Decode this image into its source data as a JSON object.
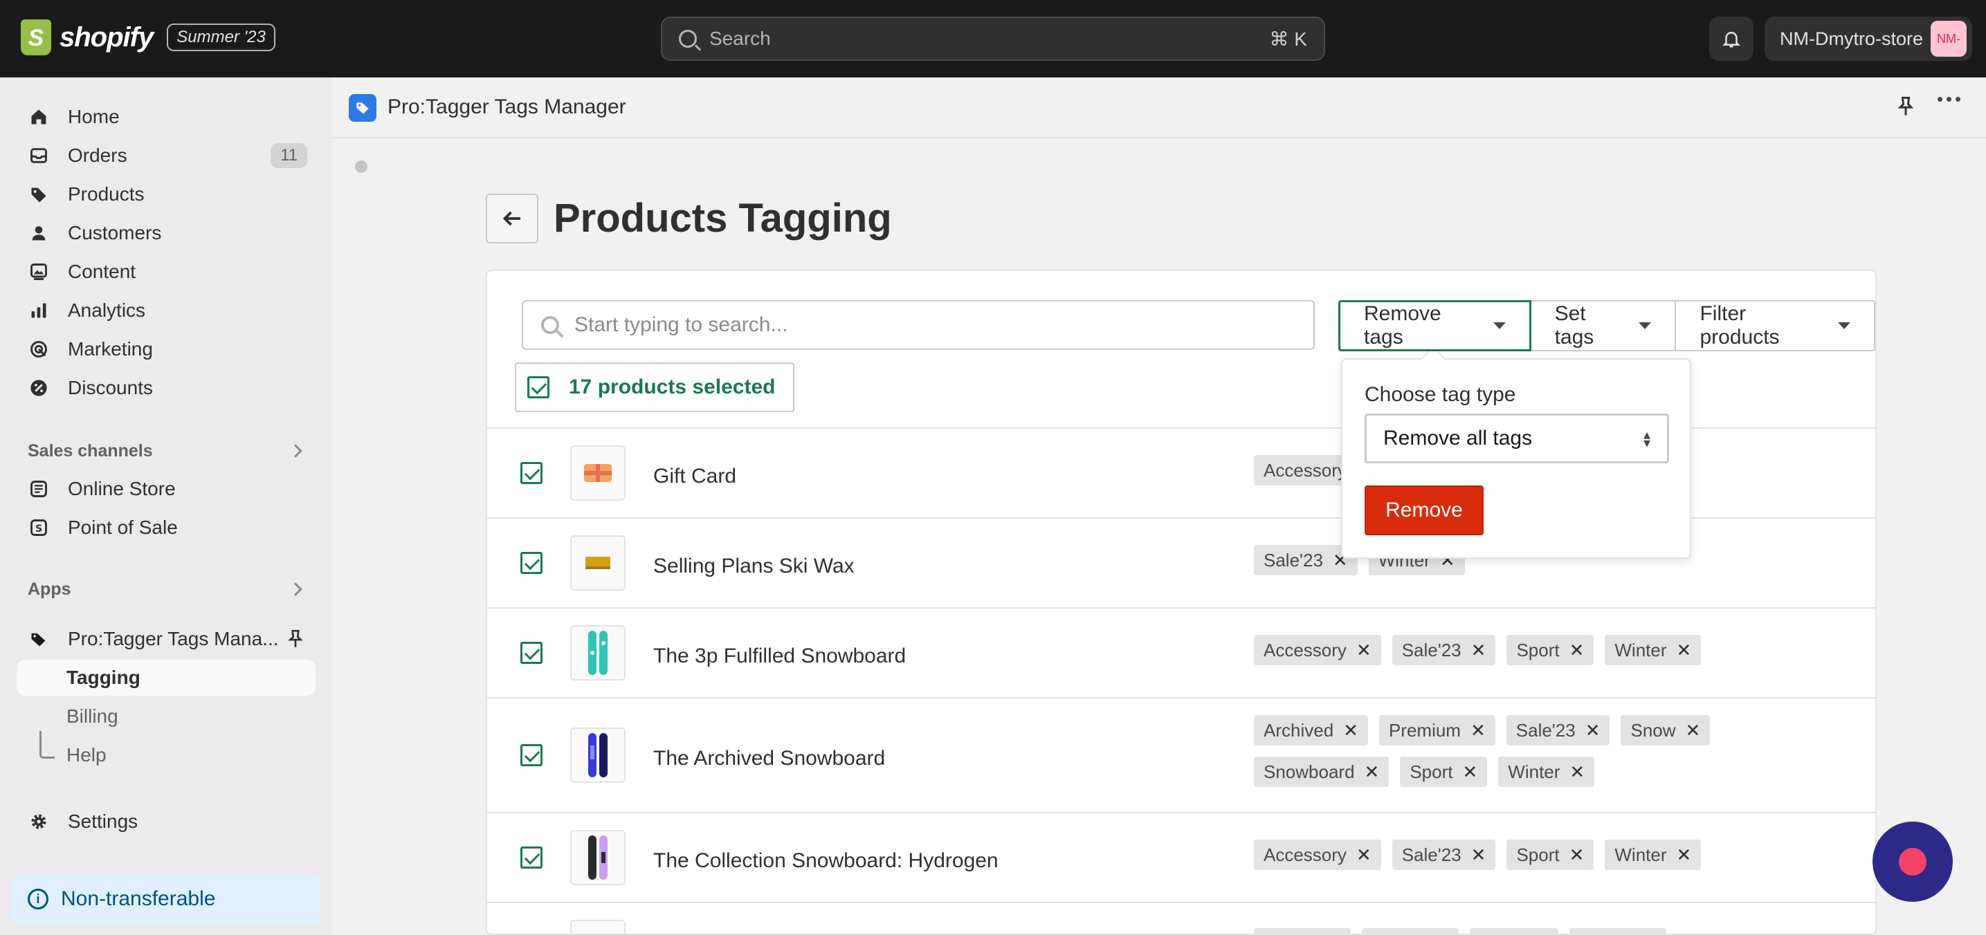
{
  "topbar": {
    "brand": "shopify",
    "edition": "Summer '23",
    "search_placeholder": "Search",
    "search_shortcut": "⌘ K",
    "store_name": "NM-Dmytro-store",
    "store_avatar": "NM-"
  },
  "sidebar": {
    "items": [
      {
        "label": "Home",
        "icon": "home-icon"
      },
      {
        "label": "Orders",
        "icon": "orders-icon",
        "badge": "11"
      },
      {
        "label": "Products",
        "icon": "tag-icon"
      },
      {
        "label": "Customers",
        "icon": "person-icon"
      },
      {
        "label": "Content",
        "icon": "content-icon"
      },
      {
        "label": "Analytics",
        "icon": "analytics-icon"
      },
      {
        "label": "Marketing",
        "icon": "marketing-icon"
      },
      {
        "label": "Discounts",
        "icon": "discount-icon"
      }
    ],
    "sales_channels_title": "Sales channels",
    "sales_channels": [
      {
        "label": "Online Store",
        "icon": "store-icon"
      },
      {
        "label": "Point of Sale",
        "icon": "pos-icon"
      }
    ],
    "apps_title": "Apps",
    "app_name": "Pro:Tagger Tags Mana...",
    "app_subitems": [
      "Tagging",
      "Billing",
      "Help"
    ],
    "settings": "Settings",
    "non_transferable": "Non-transferable"
  },
  "appbar": {
    "title": "Pro:Tagger Tags Manager"
  },
  "page": {
    "title": "Products Tagging",
    "search_placeholder": "Start typing to search...",
    "selected_label": "17 products selected",
    "buttons": {
      "remove_tags": "Remove tags",
      "set_tags": "Set tags",
      "filter_products": "Filter products"
    }
  },
  "popover": {
    "label": "Choose tag type",
    "select_value": "Remove all tags",
    "button": "Remove"
  },
  "products": [
    {
      "name": "Gift Card",
      "tags": [
        "Accessory"
      ]
    },
    {
      "name": "Selling Plans Ski Wax",
      "tags": [
        "Sale'23",
        "Winter"
      ]
    },
    {
      "name": "The 3p Fulfilled Snowboard",
      "tags": [
        "Accessory",
        "Sale'23",
        "Sport",
        "Winter"
      ]
    },
    {
      "name": "The Archived Snowboard",
      "tags": [
        "Archived",
        "Premium",
        "Sale'23",
        "Snow",
        "Snowboard",
        "Sport",
        "Winter"
      ]
    },
    {
      "name": "The Collection Snowboard: Hydrogen",
      "tags": [
        "Accessory",
        "Sale'23",
        "Sport",
        "Winter"
      ]
    }
  ],
  "colors": {
    "accent_green": "#1a7a4c",
    "danger": "#d82c0d",
    "topbar": "#1a1a1a"
  }
}
